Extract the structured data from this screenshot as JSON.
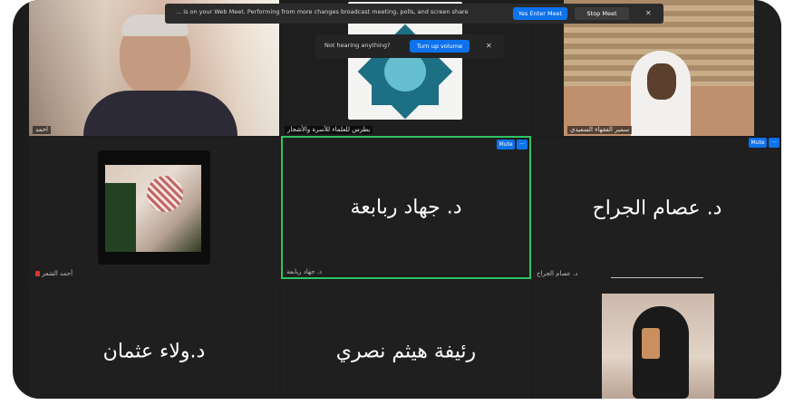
{
  "notification": {
    "text": "... is on your Web Meet. Performing from more changes broadcast meeting, polls, and screen share",
    "primary_label": "Yes Enter Meet",
    "secondary_label": "Stop Meet",
    "close_icon": "close-icon"
  },
  "unmute_prompt": {
    "text": "Not hearing anything?",
    "button_label": "Turn up volume",
    "close_icon": "close-icon"
  },
  "top_row": [
    {
      "name_tag": "احمد"
    },
    {
      "name_tag": "بطرس للعلماء للأسرة والأشجار"
    },
    {
      "name_tag": "سمير الفقهاء السعيدي"
    }
  ],
  "middle_row": [
    {
      "name_tag": "أحمد الشعر",
      "has_photo": true
    },
    {
      "display_name": "د. جهاد ربابعة",
      "name_tag": "د. جهاد ربابعة",
      "active": true
    },
    {
      "display_name": "د. عصام الجراح",
      "name_tag": "د. عصام الجراح"
    }
  ],
  "bottom_row": [
    {
      "display_name": "د.ولاء عثمان"
    },
    {
      "display_name": "رئيفة هيثم نصري"
    },
    {
      "has_photo": true
    }
  ],
  "tile_button_label": "Mute",
  "colors": {
    "screen_bg": "#1c1c1c",
    "active_border": "#2ec466",
    "accent": "#0e72ed"
  }
}
